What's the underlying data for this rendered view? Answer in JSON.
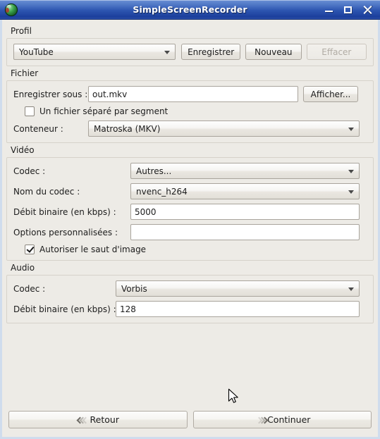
{
  "window": {
    "title": "SimpleScreenRecorder",
    "icon": "app-globe-icon",
    "controls": {
      "minimize": "minimize-icon",
      "maximize": "maximize-icon",
      "close": "close-icon"
    }
  },
  "profile": {
    "group_label": "Profil",
    "combo_value": "YouTube",
    "save_label": "Enregistrer",
    "new_label": "Nouveau",
    "delete_label": "Effacer"
  },
  "file": {
    "group_label": "Fichier",
    "save_as_label": "Enregistrer sous :",
    "save_as_value": "out.mkv",
    "browse_label": "Afficher...",
    "separate_file_label": "Un fichier séparé par segment",
    "separate_file_checked": false,
    "container_label": "Conteneur :",
    "container_value": "Matroska (MKV)"
  },
  "video": {
    "group_label": "Vidéo",
    "codec_label": "Codec :",
    "codec_value": "Autres...",
    "codec_name_label": "Nom du codec :",
    "codec_name_value": "nvenc_h264",
    "bitrate_label": "Débit binaire (en kbps) :",
    "bitrate_value": "5000",
    "custom_options_label": "Options personnalisées :",
    "custom_options_value": "",
    "allow_frame_skip_label": "Autoriser le saut d'image",
    "allow_frame_skip_checked": true
  },
  "audio": {
    "group_label": "Audio",
    "codec_label": "Codec :",
    "codec_value": "Vorbis",
    "bitrate_label": "Débit binaire (en kbps) :",
    "bitrate_value": "128"
  },
  "navigation": {
    "back_label": "Retour",
    "continue_label": "Continuer"
  },
  "colors": {
    "titlebar_start": "#6a8fd4",
    "titlebar_end": "#1b3f9c",
    "window_bg": "#edebe6",
    "frame": "#cfdced",
    "field_bg": "#ffffff",
    "border": "#a9a49c"
  }
}
